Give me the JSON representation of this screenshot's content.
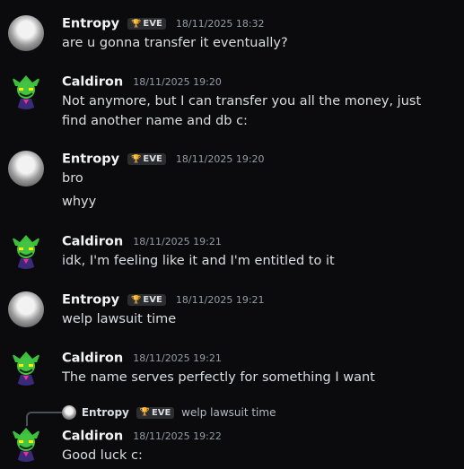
{
  "messages": [
    {
      "author": "Entropy",
      "tag": "EVE",
      "time": "18/11/2025 18:32",
      "lines": [
        "are u gonna transfer it eventually?"
      ]
    },
    {
      "author": "Caldiron",
      "time": "18/11/2025 19:20",
      "lines": [
        "Not anymore, but I can transfer you all the money, just find another name and db c:"
      ]
    },
    {
      "author": "Entropy",
      "tag": "EVE",
      "time": "18/11/2025 19:20",
      "lines": [
        "bro",
        "whyy"
      ]
    },
    {
      "author": "Caldiron",
      "time": "18/11/2025 19:21",
      "lines": [
        "idk, I'm feeling like it and I'm entitled to it"
      ]
    },
    {
      "author": "Entropy",
      "tag": "EVE",
      "time": "18/11/2025 19:21",
      "lines": [
        "welp lawsuit time"
      ]
    },
    {
      "author": "Caldiron",
      "time": "18/11/2025 19:21",
      "lines": [
        "The name serves perfectly for something I want"
      ]
    },
    {
      "author": "Caldiron",
      "time": "18/11/2025 19:22",
      "lines": [
        "Good luck c:"
      ]
    }
  ],
  "reply": {
    "author": "Entropy",
    "tag": "EVE",
    "text": "welp lawsuit time"
  },
  "colors": {
    "background": "#0b0b0e",
    "text": "#dbdee1",
    "muted": "#949ba4",
    "tag_bg": "#2b2d31"
  },
  "icons": {
    "tag_icon": "trophy-icon",
    "caldiron_avatar": "green-goblin-icon",
    "entropy_avatar": "anime-girl-avatar"
  }
}
